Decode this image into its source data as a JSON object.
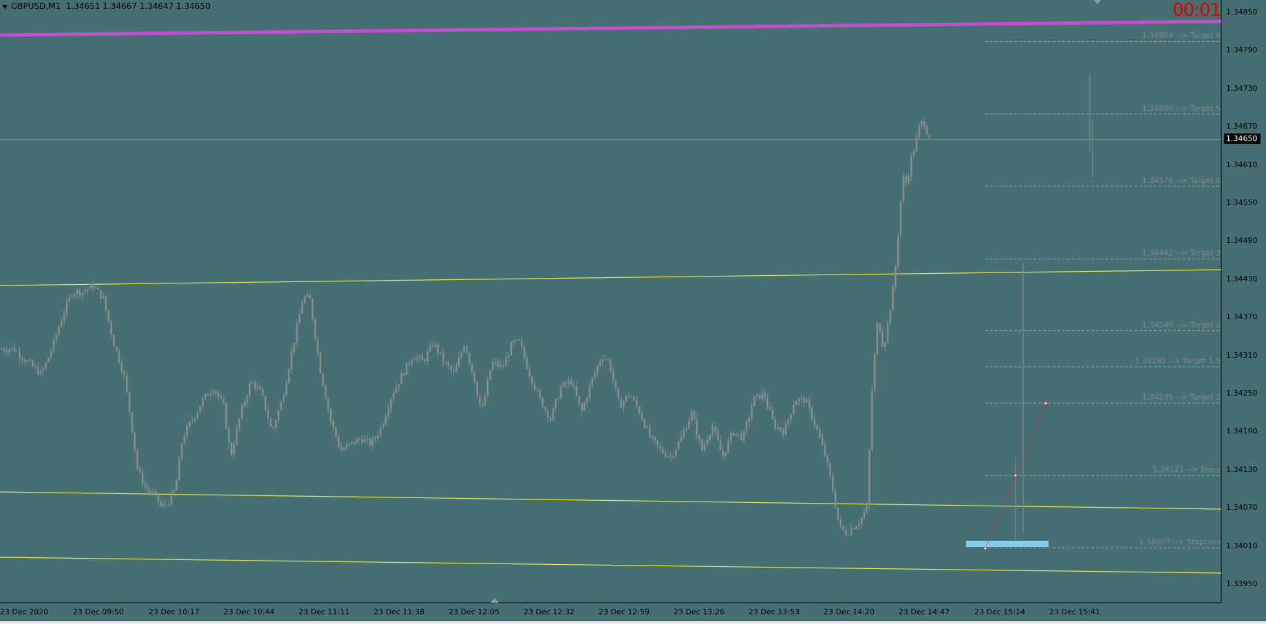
{
  "header": {
    "symbol": "GBPUSD,M1",
    "ohlc": "1.34651 1.34667 1.34647 1.34650"
  },
  "timer": "00:01",
  "current_price": "1.34650",
  "axes": {
    "y_ticks": [
      "1.34850",
      "1.34790",
      "1.34730",
      "1.34670",
      "1.34610",
      "1.34550",
      "1.34490",
      "1.34430",
      "1.34370",
      "1.34310",
      "1.34250",
      "1.34190",
      "1.34130",
      "1.34070",
      "1.34010",
      "1.33950"
    ],
    "x_ticks": [
      "23 Dec 2020",
      "23 Dec 09:50",
      "23 Dec 10:17",
      "23 Dec 10:44",
      "23 Dec 11:11",
      "23 Dec 11:38",
      "23 Dec 12:05",
      "23 Dec 12:32",
      "23 Dec 12:59",
      "23 Dec 13:26",
      "23 Dec 13:53",
      "23 Dec 14:20",
      "23 Dec 14:47",
      "23 Dec 15:14",
      "23 Dec 15:41"
    ]
  },
  "levels": [
    {
      "price": "1.34804",
      "label": "1.34804 --> Target 6"
    },
    {
      "price": "1.34690",
      "label": "1.34690 --> Target 5"
    },
    {
      "price": "1.34576",
      "label": "1.34576 --> Target 4"
    },
    {
      "price": "1.34462",
      "label": "1.34462 --> Target 3"
    },
    {
      "price": "1.34349",
      "label": "1.34349 --> Target 2"
    },
    {
      "price": "1.34292",
      "label": "1.34292 --> Target 1.5"
    },
    {
      "price": "1.34235",
      "label": "1.34235 --> Target 1"
    },
    {
      "price": "1.34121",
      "label": "1.34121 --> Entry"
    },
    {
      "price": "1.34007",
      "label": "1.34007 --> StopLoss"
    }
  ],
  "colors": {
    "background": "#456f70",
    "candle": "#858d8f",
    "channel": "#e6e65a",
    "trend_line": "#c050d0",
    "stoploss_box": "#87cdea",
    "timer": "#e00000",
    "level_line": "#8da1a3",
    "zigzag": "#d03040"
  },
  "chart_data": {
    "type": "candlestick",
    "series_note": "",
    "ylim": [
      1.3392,
      1.3487
    ],
    "approx_close_path": [
      [
        0,
        1.3432
      ],
      [
        20,
        1.3432
      ],
      [
        40,
        1.343
      ],
      [
        60,
        1.3428
      ],
      [
        75,
        1.3432
      ],
      [
        90,
        1.3437
      ],
      [
        105,
        1.3441
      ],
      [
        120,
        1.3441
      ],
      [
        135,
        1.3442
      ],
      [
        150,
        1.344
      ],
      [
        165,
        1.3433
      ],
      [
        180,
        1.3428
      ],
      [
        190,
        1.3421
      ],
      [
        200,
        1.3413
      ],
      [
        212,
        1.341
      ],
      [
        225,
        1.3409
      ],
      [
        235,
        1.3407
      ],
      [
        245,
        1.3408
      ],
      [
        255,
        1.341
      ],
      [
        265,
        1.3418
      ],
      [
        280,
        1.3421
      ],
      [
        295,
        1.3424
      ],
      [
        310,
        1.3426
      ],
      [
        325,
        1.3423
      ],
      [
        335,
        1.3415
      ],
      [
        350,
        1.3422
      ],
      [
        365,
        1.3427
      ],
      [
        380,
        1.3425
      ],
      [
        395,
        1.3419
      ],
      [
        410,
        1.3424
      ],
      [
        425,
        1.3432
      ],
      [
        440,
        1.344
      ],
      [
        450,
        1.344
      ],
      [
        465,
        1.3429
      ],
      [
        480,
        1.3421
      ],
      [
        495,
        1.3416
      ],
      [
        510,
        1.3417
      ],
      [
        525,
        1.3418
      ],
      [
        540,
        1.3417
      ],
      [
        555,
        1.342
      ],
      [
        570,
        1.3425
      ],
      [
        585,
        1.3428
      ],
      [
        600,
        1.3431
      ],
      [
        615,
        1.343
      ],
      [
        630,
        1.3433
      ],
      [
        645,
        1.343
      ],
      [
        660,
        1.3428
      ],
      [
        675,
        1.3433
      ],
      [
        690,
        1.3427
      ],
      [
        700,
        1.3422
      ],
      [
        715,
        1.343
      ],
      [
        730,
        1.3429
      ],
      [
        745,
        1.3433
      ],
      [
        755,
        1.3433
      ],
      [
        770,
        1.3428
      ],
      [
        785,
        1.3424
      ],
      [
        800,
        1.3421
      ],
      [
        815,
        1.3426
      ],
      [
        830,
        1.3427
      ],
      [
        845,
        1.3422
      ],
      [
        860,
        1.3427
      ],
      [
        875,
        1.3431
      ],
      [
        885,
        1.343
      ],
      [
        900,
        1.3423
      ],
      [
        915,
        1.3425
      ],
      [
        930,
        1.3422
      ],
      [
        945,
        1.3418
      ],
      [
        960,
        1.3416
      ],
      [
        975,
        1.3415
      ],
      [
        990,
        1.3418
      ],
      [
        1005,
        1.3422
      ],
      [
        1020,
        1.3416
      ],
      [
        1035,
        1.342
      ],
      [
        1050,
        1.3415
      ],
      [
        1065,
        1.3419
      ],
      [
        1080,
        1.3418
      ],
      [
        1095,
        1.3424
      ],
      [
        1110,
        1.3425
      ],
      [
        1125,
        1.342
      ],
      [
        1140,
        1.3419
      ],
      [
        1155,
        1.3424
      ],
      [
        1170,
        1.3424
      ],
      [
        1185,
        1.342
      ],
      [
        1200,
        1.3415
      ],
      [
        1210,
        1.341
      ],
      [
        1220,
        1.3404
      ],
      [
        1230,
        1.3403
      ],
      [
        1240,
        1.3404
      ],
      [
        1250,
        1.3405
      ],
      [
        1260,
        1.3407
      ],
      [
        1268,
        1.3427
      ],
      [
        1276,
        1.3437
      ],
      [
        1284,
        1.3432
      ],
      [
        1292,
        1.3437
      ],
      [
        1300,
        1.3443
      ],
      [
        1306,
        1.3451
      ],
      [
        1312,
        1.3459
      ],
      [
        1318,
        1.3458
      ],
      [
        1324,
        1.3462
      ],
      [
        1330,
        1.3464
      ],
      [
        1336,
        1.3467
      ],
      [
        1342,
        1.3468
      ],
      [
        1348,
        1.3466
      ],
      [
        1354,
        1.3465
      ]
    ]
  }
}
